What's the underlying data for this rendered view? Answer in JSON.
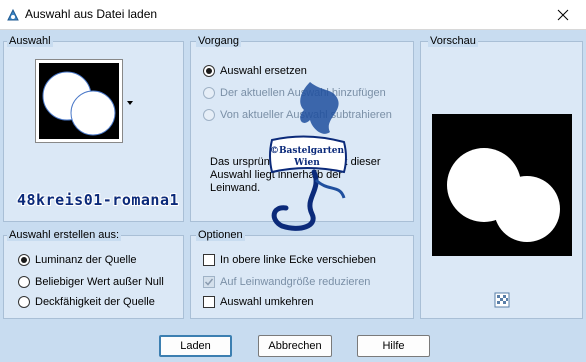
{
  "window": {
    "title": "Auswahl aus Datei laden"
  },
  "auswahl": {
    "label": "Auswahl"
  },
  "vorgang": {
    "label": "Vorgang",
    "options": [
      {
        "label": "Auswahl ersetzen",
        "checked": true,
        "enabled": true
      },
      {
        "label": "Der aktuellen Auswahl hinzufügen",
        "checked": false,
        "enabled": false
      },
      {
        "label": "Von aktueller Auswahl subtrahieren",
        "checked": false,
        "enabled": false
      }
    ],
    "note": "Das ursprüngliche Rechteck dieser Auswahl liegt innerhalb der Leinwand."
  },
  "vorschau": {
    "label": "Vorschau"
  },
  "erstellen": {
    "label": "Auswahl erstellen aus:",
    "options": [
      {
        "label": "Luminanz der Quelle",
        "checked": true
      },
      {
        "label": "Beliebiger Wert außer Null",
        "checked": false
      },
      {
        "label": "Deckfähigkeit der Quelle",
        "checked": false
      }
    ]
  },
  "optionen": {
    "label": "Optionen",
    "items": [
      {
        "label": "In obere linke Ecke verschieben",
        "checked": false,
        "enabled": true
      },
      {
        "label": "Auf Leinwandgröße reduzieren",
        "checked": true,
        "enabled": false
      },
      {
        "label": "Auswahl umkehren",
        "checked": false,
        "enabled": true
      }
    ]
  },
  "buttons": {
    "load": "Laden",
    "cancel": "Abbrechen",
    "help": "Hilfe"
  },
  "watermark": {
    "text": "48kreis01-romana1",
    "logo_line1": "©Bastelgarten",
    "logo_line2": "Wien"
  },
  "colors": {
    "dialog_bg": "#c8dcf0",
    "group_bg": "#dbe8f6",
    "accent": "#3c7fb1",
    "watermark": "#0b2a7a"
  }
}
